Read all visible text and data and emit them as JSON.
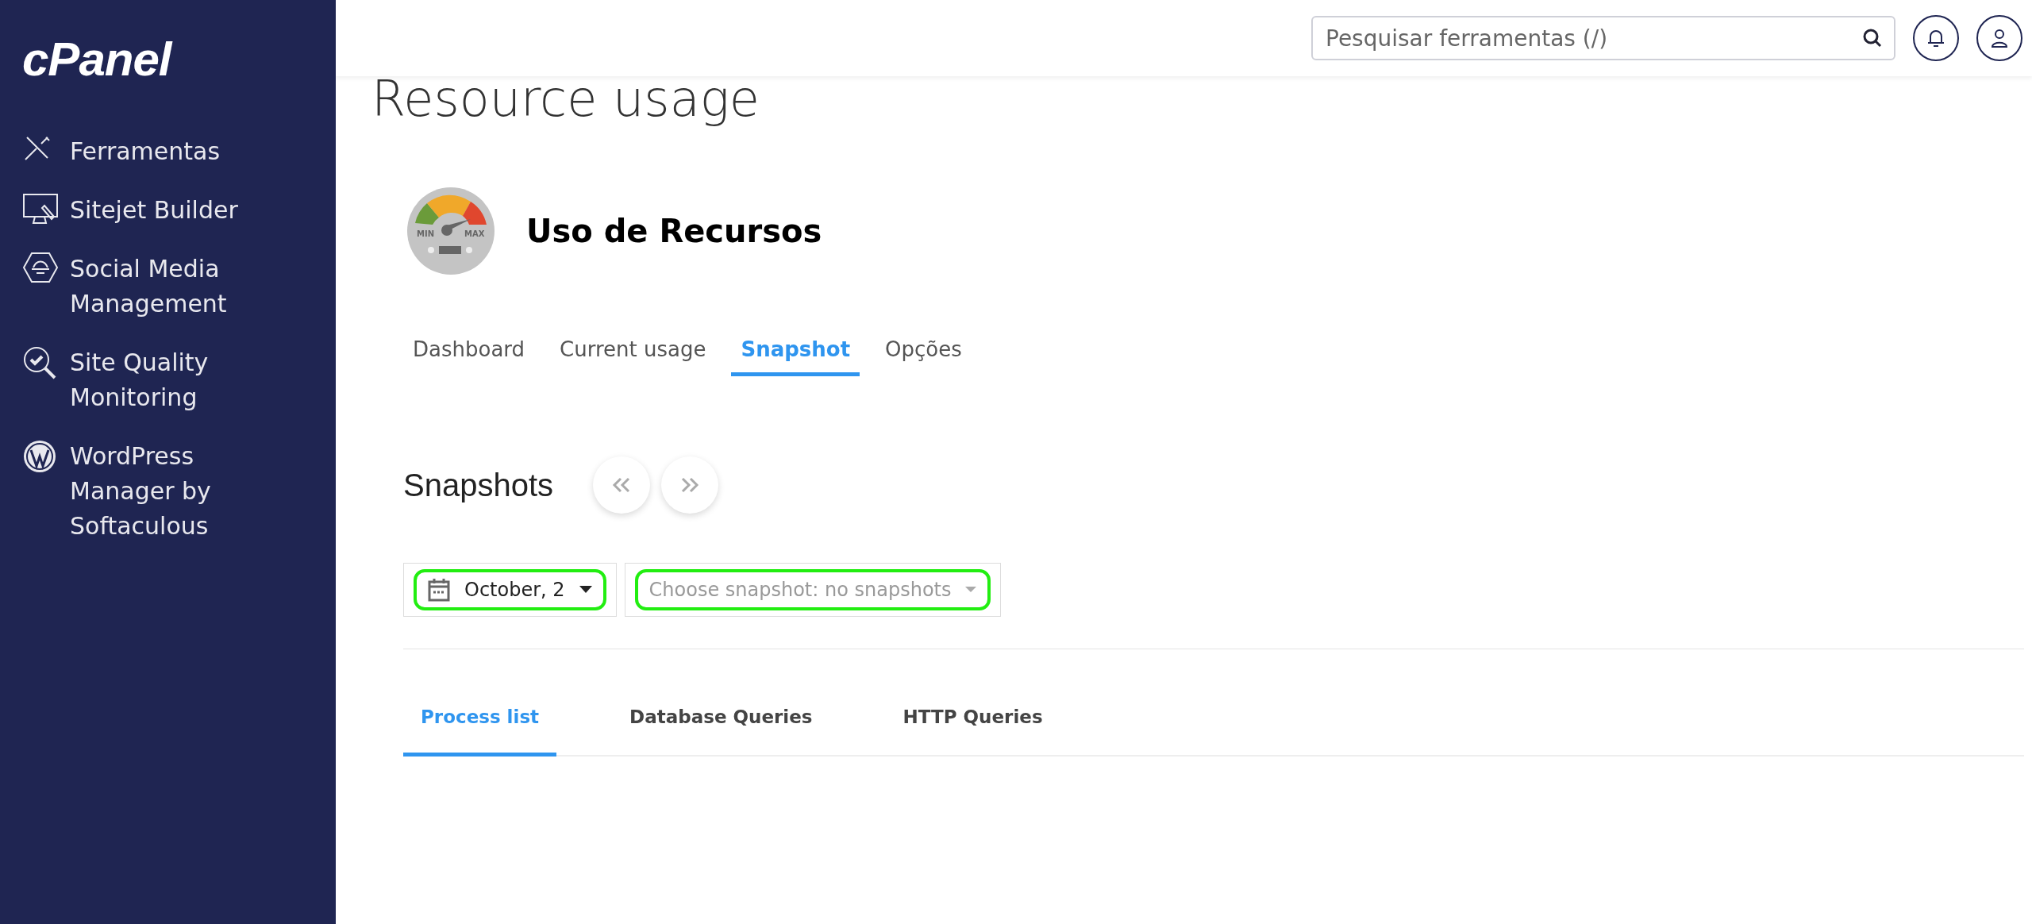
{
  "sidebar": {
    "logo": "cPanel",
    "items": [
      {
        "kind": "tools",
        "label": "Ferramentas"
      },
      {
        "kind": "monitor",
        "label": "Sitejet Builder"
      },
      {
        "kind": "hexagon",
        "label": "Social Media Management"
      },
      {
        "kind": "magnifier",
        "label": "Site Quality Monitoring"
      },
      {
        "kind": "wordpress",
        "label": "WordPress Manager by Softaculous"
      }
    ]
  },
  "header": {
    "search": {
      "placeholder": "Pesquisar ferramentas (/)"
    }
  },
  "page_title": "Resource usage",
  "app": {
    "title": "Uso de Recursos",
    "gauge_labels": [
      "MIN",
      "MAX"
    ]
  },
  "tabs": [
    {
      "label": "Dashboard",
      "selected": false
    },
    {
      "label": "Current usage",
      "selected": false
    },
    {
      "label": "Snapshot",
      "selected": true
    },
    {
      "label": "Opções",
      "selected": false
    }
  ],
  "snapshots": {
    "title": "Snapshots",
    "date": {
      "value": "October, 2",
      "highlighted": true
    },
    "snapshot": {
      "placeholder": "Choose snapshot: no snapshots",
      "highlighted": true
    }
  },
  "sub_tabs": [
    {
      "label": "Process list",
      "selected": true
    },
    {
      "label": "Database Queries",
      "selected": false
    },
    {
      "label": "HTTP Queries",
      "selected": false
    }
  ]
}
